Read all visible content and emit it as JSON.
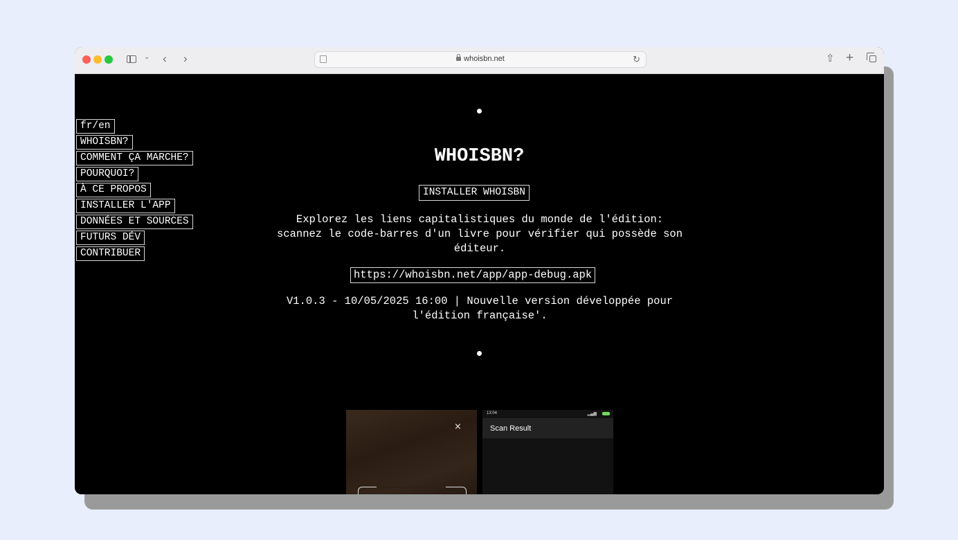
{
  "browser": {
    "url": "whoisbn.net"
  },
  "nav": {
    "items": [
      "fr/en",
      "WHOISBN?",
      "COMMENT ÇA MARCHE?",
      "POURQUOI?",
      "À CE PROPOS",
      "INSTALLER L'APP",
      "DONNÉES ET SOURCES",
      "FUTURS DÉV",
      "CONTRIBUER"
    ]
  },
  "main": {
    "title": "WHOISBN?",
    "install_button": "INSTALLER WHOISBN",
    "description": "Explorez les liens capitalistiques du monde de l'édition: scannez le code-barres d'un livre pour vérifier qui possède son éditeur.",
    "apk_link": "https://whoisbn.net/app/app-debug.apk",
    "version": "V1.0.3 - 10/05/2025 16:00 | Nouvelle version développée pour l'édition française'."
  },
  "screenshots": {
    "close_glyph": "×",
    "phone_time": "13:04",
    "phone_title": "Scan Result"
  },
  "icons": {
    "chevron_down": "⌄",
    "back": "‹",
    "forward": "›",
    "reload": "↻",
    "share": "⇧",
    "plus": "+"
  }
}
